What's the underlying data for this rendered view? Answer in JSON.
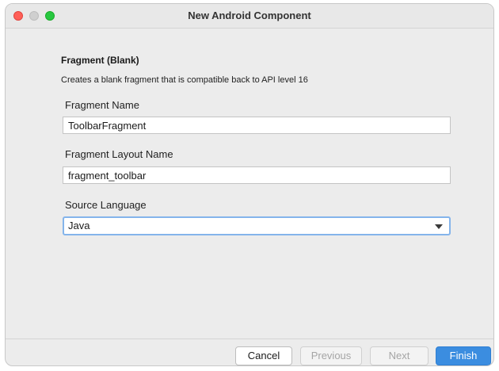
{
  "window": {
    "title": "New Android Component"
  },
  "dialog": {
    "heading": "Fragment (Blank)",
    "description": "Creates a blank fragment that is compatible back to API level 16"
  },
  "form": {
    "fragment_name": {
      "label": "Fragment Name",
      "value": "ToolbarFragment"
    },
    "layout_name": {
      "label": "Fragment Layout Name",
      "value": "fragment_toolbar"
    },
    "source_language": {
      "label": "Source Language",
      "selected": "Java"
    }
  },
  "buttons": {
    "cancel": "Cancel",
    "previous": "Previous",
    "next": "Next",
    "finish": "Finish"
  },
  "colors": {
    "accent": "#3b8de0",
    "focus_ring": "#84b4eb",
    "close_button": "#ff5f57",
    "zoom_button": "#28c840"
  },
  "icons": [
    "close-icon",
    "minimize-icon",
    "zoom-icon",
    "chevron-down-icon"
  ]
}
